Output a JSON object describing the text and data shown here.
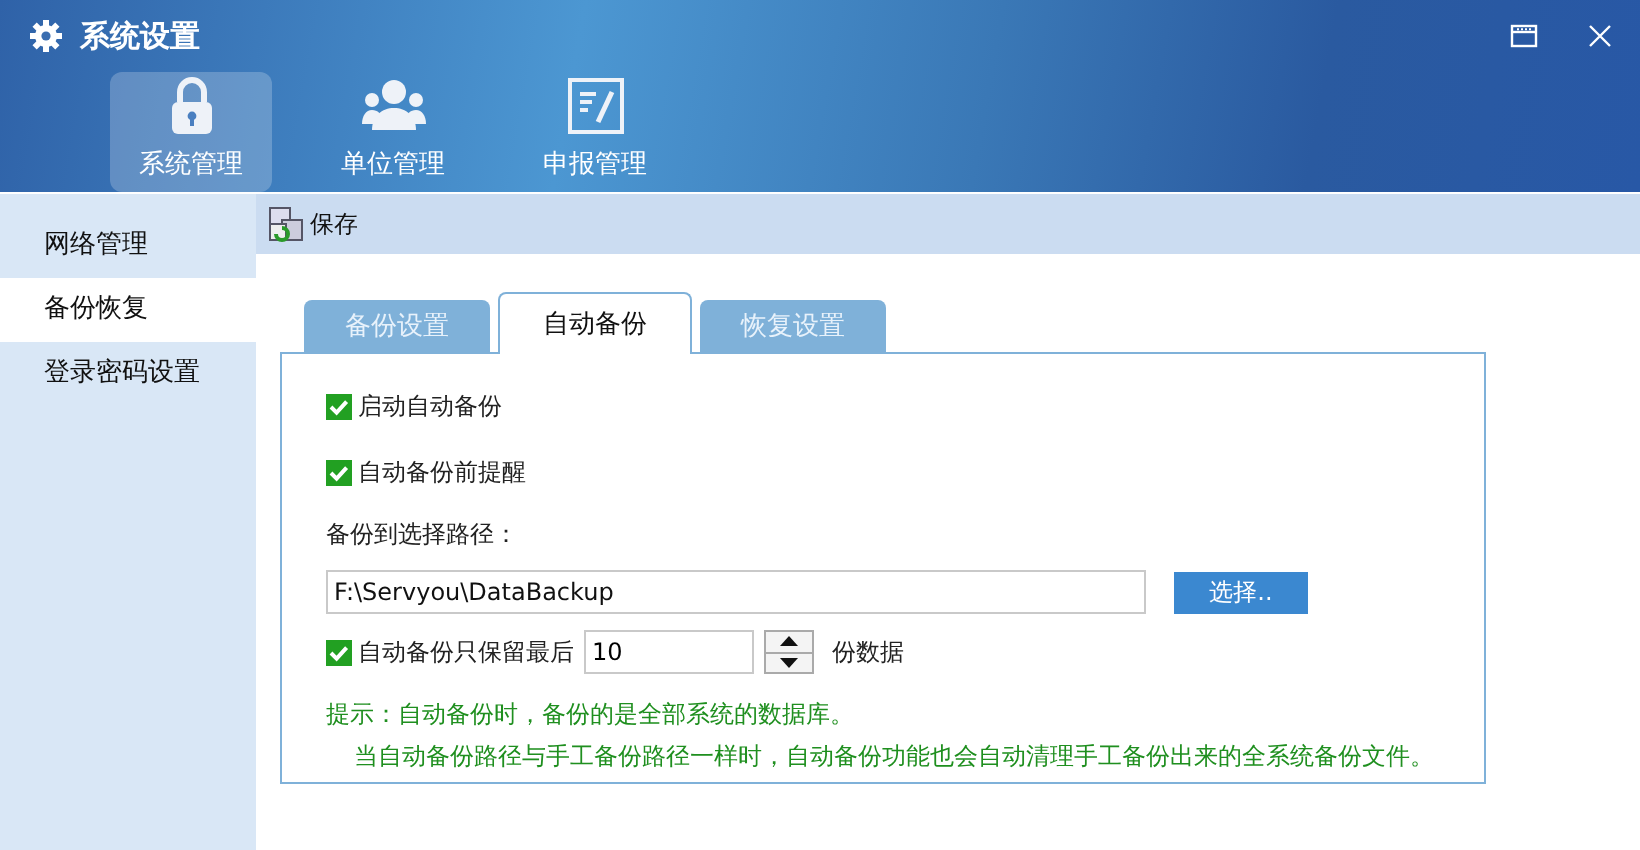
{
  "window": {
    "title": "系统设置"
  },
  "nav": [
    {
      "label": "系统管理",
      "selected": true,
      "kind": "lock"
    },
    {
      "label": "单位管理",
      "selected": false,
      "kind": "users"
    },
    {
      "label": "申报管理",
      "selected": false,
      "kind": "form"
    }
  ],
  "sidebar": {
    "items": [
      {
        "label": "网络管理",
        "selected": false
      },
      {
        "label": "备份恢复",
        "selected": true
      },
      {
        "label": "登录密码设置",
        "selected": false
      }
    ]
  },
  "toolbar": {
    "save": "保存"
  },
  "tabs": [
    {
      "label": "备份设置",
      "selected": false
    },
    {
      "label": "自动备份",
      "selected": true
    },
    {
      "label": "恢复设置",
      "selected": false
    }
  ],
  "auto_backup": {
    "enable": {
      "label": "启动自动备份",
      "checked": true
    },
    "remind": {
      "label": "自动备份前提醒",
      "checked": true
    },
    "path_label": "备份到选择路径：",
    "path": "F:\\Servyou\\DataBackup",
    "choose_button": "选择..",
    "keep": {
      "checked": true,
      "label": "自动备份只保留最后",
      "value": "10",
      "suffix": "份数据"
    },
    "hint_lines": [
      "提示：自动备份时，备份的是全部系统的数据库。",
      "当自动备份路径与手工备份路径一样时，自动备份功能也会自动清理手工备份出来的全系统备份文件。"
    ]
  }
}
